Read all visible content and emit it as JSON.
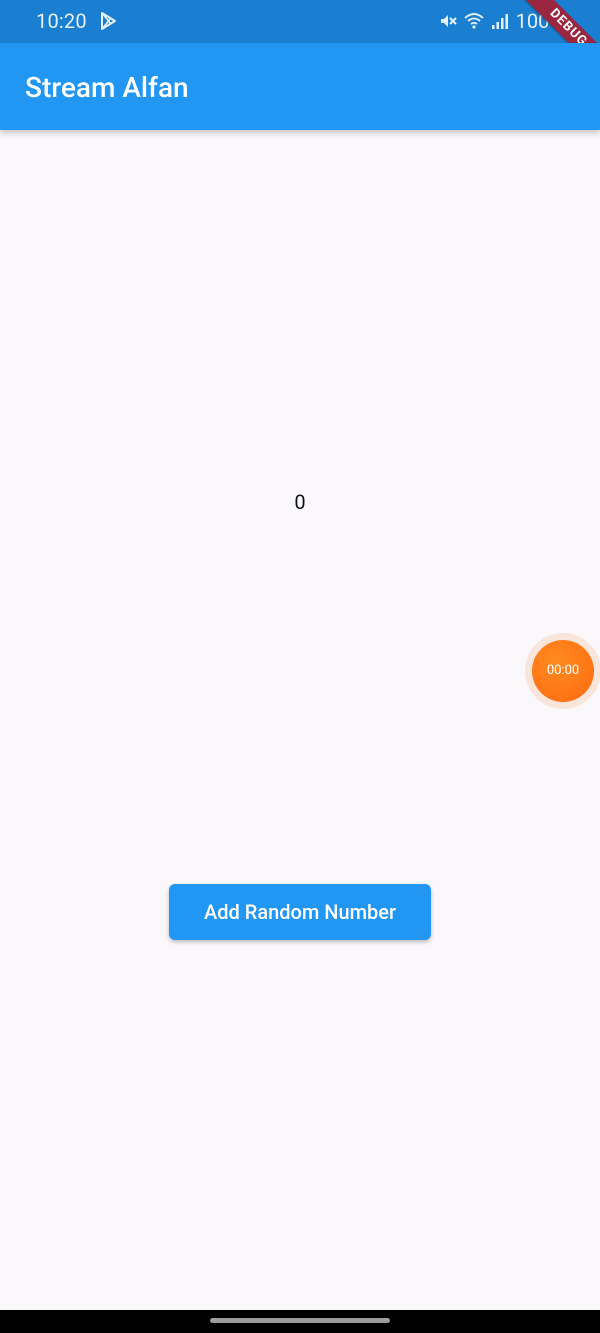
{
  "status_bar": {
    "time": "10:20",
    "battery": "100%"
  },
  "debug_banner": "DEBUG",
  "app_bar": {
    "title": "Stream Alfan"
  },
  "main": {
    "counter_value": "0",
    "add_button_label": "Add Random Number"
  },
  "overlay": {
    "timer": "00:00"
  },
  "colors": {
    "primary": "#2196f3",
    "status_bar": "#1a7fd0",
    "background": "#faf8fb",
    "timer_orange": "#ff7a18",
    "debug_ribbon": "#9b2640"
  }
}
